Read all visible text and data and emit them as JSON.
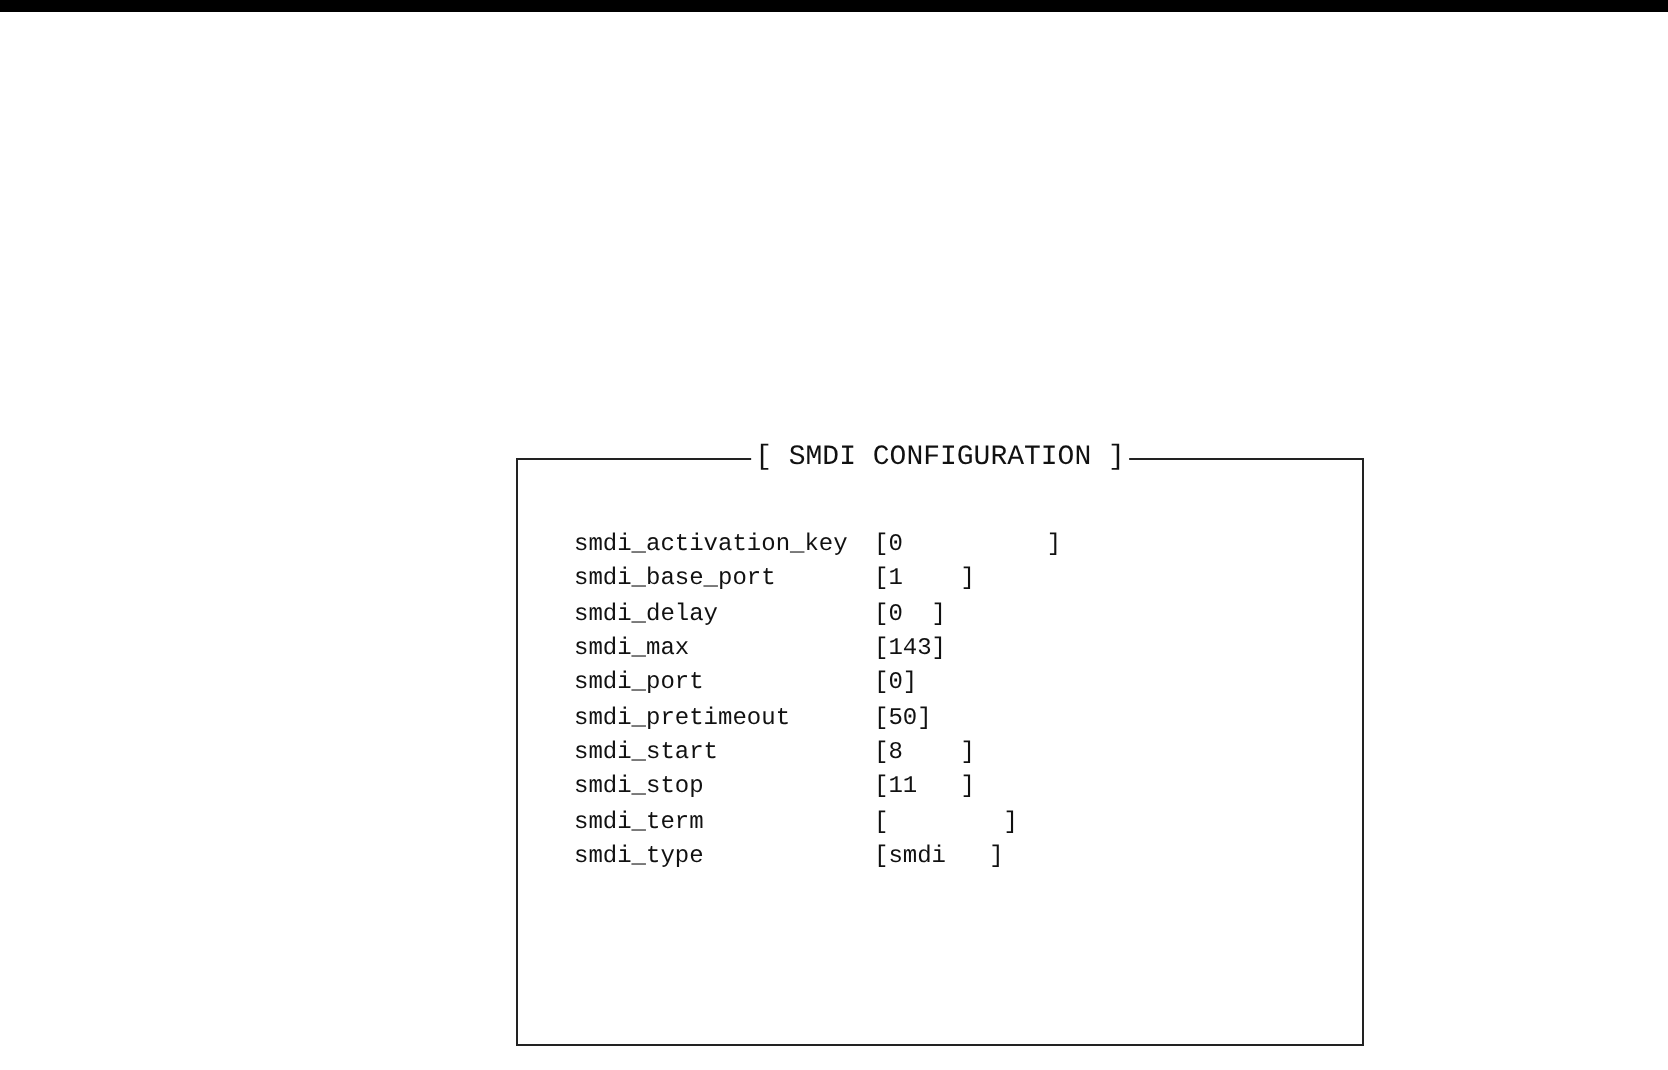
{
  "panel": {
    "title": "[ SMDI CONFIGURATION ]",
    "rows": [
      {
        "name": "smdi_activation_key",
        "value": "[0          ]"
      },
      {
        "name": "smdi_base_port",
        "value": "[1    ]"
      },
      {
        "name": "smdi_delay",
        "value": "[0  ]"
      },
      {
        "name": "smdi_max",
        "value": "[143]"
      },
      {
        "name": "smdi_port",
        "value": "[0]"
      },
      {
        "name": "smdi_pretimeout",
        "value": "[50]"
      },
      {
        "name": "smdi_start",
        "value": "[8    ]"
      },
      {
        "name": "smdi_stop",
        "value": "[11   ]"
      },
      {
        "name": "smdi_term",
        "value": "[        ]"
      },
      {
        "name": "smdi_type",
        "value": "[smdi   ]"
      }
    ]
  }
}
